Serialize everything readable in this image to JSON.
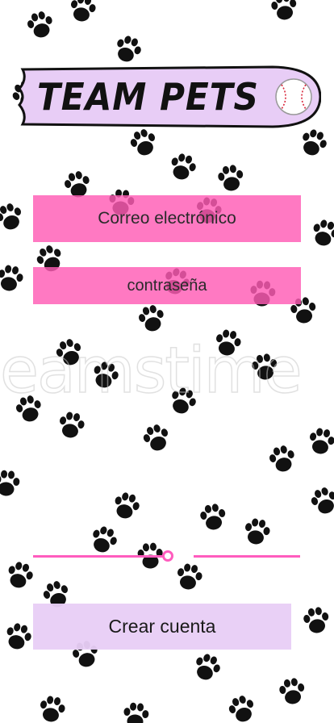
{
  "app": {
    "title": "TEAM PETS"
  },
  "header": {
    "logo_icon": "baseball-icon"
  },
  "background": {
    "pattern_icon": "paw-print-icon",
    "watermark_text": "eamstime"
  },
  "form": {
    "email_label": "Correo electrónico",
    "password_label": "contraseña"
  },
  "actions": {
    "create_account_label": "Crear cuenta"
  },
  "colors": {
    "field_pink": "#ff5cb4",
    "divider_pink": "#ff5cbe",
    "banner_lavender": "#e8cdf6",
    "button_lavender": "#e8cef6"
  }
}
